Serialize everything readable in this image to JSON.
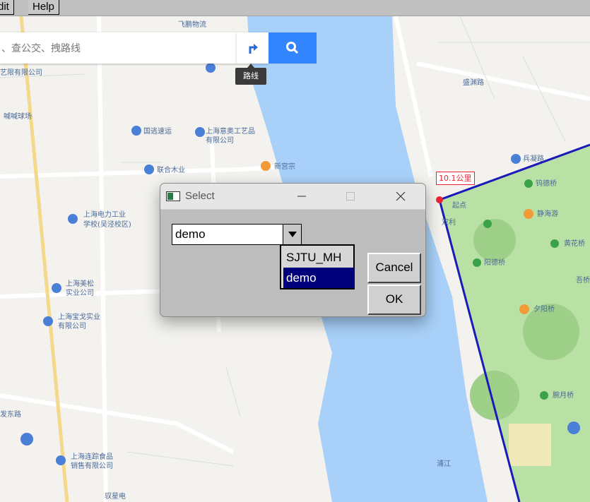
{
  "menubar": {
    "items": [
      "dit",
      "Help"
    ]
  },
  "search": {
    "placeholder": "、查公交、拽路线"
  },
  "tooltip": {
    "text": "路线"
  },
  "map": {
    "poi_labels": [
      "飞鹏物流",
      "艺限有限公司",
      "喊喊球场",
      "国逃速运",
      "上海意奥工艺品",
      "有限公司",
      "新宫宗",
      "联合木业",
      "上海电力工业",
      "学校(吴泾校区)",
      "上海美松",
      "实业公司",
      "上海宝戈实业",
      "有限公司",
      "上海连踪食品",
      "销售有限公司",
      "发东路",
      "盛渊路",
      "兵凝路",
      "双利",
      "钨德桥",
      "静海游",
      "黄花桥",
      "阳德桥",
      "吾桥",
      "夕阳桥",
      "腕月桥",
      "浦江",
      "起点",
      "驭星电"
    ],
    "route_color": "#1a1ab8",
    "distance_label": "10.1公里",
    "start_label": "起点"
  },
  "dialog": {
    "title": "Select",
    "combo_value": "demo",
    "options": [
      "SJTU_MH",
      "demo"
    ],
    "selected_option": "demo",
    "cancel_label": "Cancel",
    "ok_label": "OK"
  },
  "colors": {
    "water": "#a8d0f8",
    "park": "#b9e0a5",
    "search_button": "#3385ff",
    "selection": "#00007b"
  }
}
